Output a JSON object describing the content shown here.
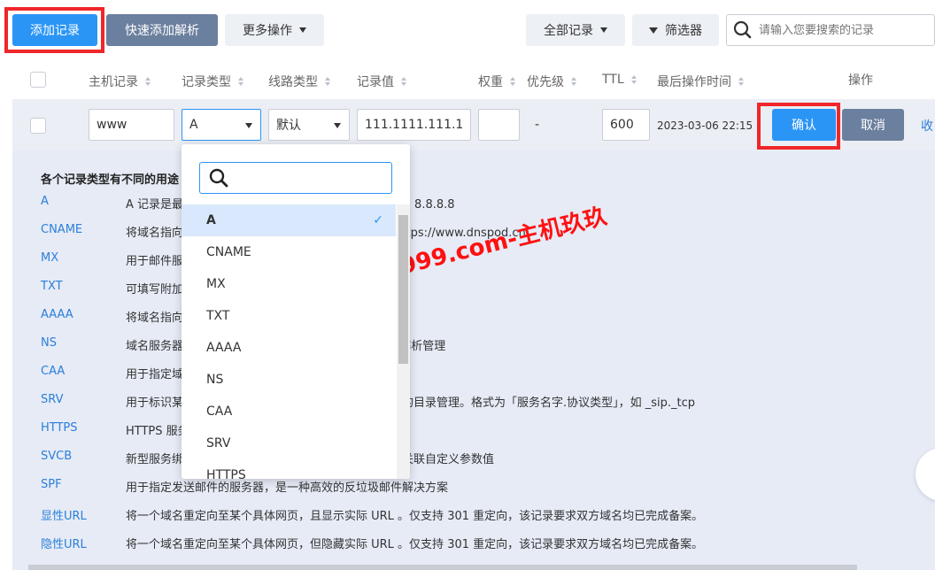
{
  "toolbar": {
    "add_record": "添加记录",
    "quick_add": "快速添加解析",
    "more_ops": "更多操作",
    "all_records": "全部记录",
    "filter": "筛选器",
    "search_placeholder": "请输入您要搜索的记录"
  },
  "columns": {
    "host": "主机记录",
    "type": "记录类型",
    "line": "线路类型",
    "value": "记录值",
    "weight": "权重",
    "priority": "优先级",
    "ttl": "TTL",
    "last_op": "最后操作时间",
    "actions": "操作"
  },
  "edit_row": {
    "host": "www",
    "type": "A",
    "line": "默认",
    "value": "111.1111.111.1",
    "weight": "",
    "priority": "-",
    "ttl": "600",
    "time": "2023-03-06 22:15",
    "confirm": "确认",
    "cancel": "取消",
    "collapse": "收"
  },
  "help": {
    "title": "各个记录类型有不同的用途",
    "rows": [
      {
        "k": "A",
        "v": "A 记录是最常用的类型，将域名指向一个 IPv4 地址，如 8.8.8.8"
      },
      {
        "k": "CNAME",
        "v": "将域名指向另一个域名地址，与其保持相同解析，如 https://www.dnspod.cn"
      },
      {
        "k": "MX",
        "v": "用于邮件服务器，相关参数一般由邮件注册商提供"
      },
      {
        "k": "TXT",
        "v": "可填写附加文本信息，常用于域名验证"
      },
      {
        "k": "AAAA",
        "v": "将域名指向一个 IPv6 地址，如 ff06:0:0:0:0:0:0:c3"
      },
      {
        "k": "NS",
        "v": "域名服务器记录，可将指定域名交由其他 DNS 服务商解析管理"
      },
      {
        "k": "CAA",
        "v": "用于指定域名允许的证书颁发机构，降低证书错发风险"
      },
      {
        "k": "SRV",
        "v": "用于标识某台服务器使用了某个服务，常见于微软系统的目录管理。格式为「服务名字.协议类型」，如 _sip._tcp"
      },
      {
        "k": "HTTPS",
        "v": "HTTPS 服务绑定记录，可提升客户端连接效率与性能"
      },
      {
        "k": "SVCB",
        "v": "新型服务绑定记录类型，允许服务指向多个客户端，并关联自定义参数值"
      },
      {
        "k": "SPF",
        "v": "用于指定发送邮件的服务器，是一种高效的反垃圾邮件解决方案"
      },
      {
        "k": "显性URL",
        "v": "将一个域名重定向至某个具体网页，且显示实际 URL 。仅支持 301 重定向，该记录要求双方域名均已完成备案。"
      },
      {
        "k": "隐性URL",
        "v": "将一个域名重定向至某个具体网页，但隐藏实际 URL 。仅支持 301 重定向，该记录要求双方域名均已完成备案。"
      }
    ]
  },
  "dropdown": {
    "search_placeholder": "",
    "options": [
      "A",
      "CNAME",
      "MX",
      "TXT",
      "AAAA",
      "NS",
      "CAA",
      "SRV",
      "HTTPS"
    ],
    "selected": "A"
  },
  "watermark": "zhuji999.com-主机玖玖",
  "colors": {
    "primary": "#2b95f6",
    "highlight": "#f0262a",
    "panel": "#e6ebf6"
  }
}
